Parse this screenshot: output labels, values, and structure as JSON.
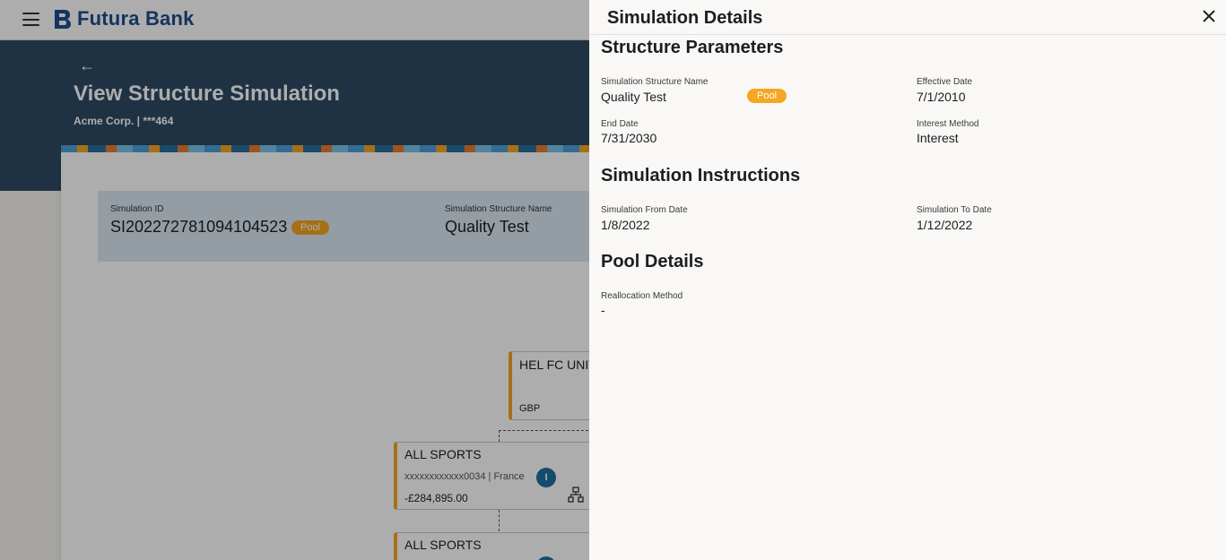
{
  "brand": {
    "name": "Futura Bank"
  },
  "page": {
    "title": "View Structure Simulation",
    "subtitle": "Acme Corp. | ***464",
    "back_icon": "arrow-left-icon"
  },
  "summary": {
    "simulation_id_label": "Simulation ID",
    "simulation_id": "SI202272781094104523",
    "type_badge": "Pool",
    "structure_name_label": "Simulation Structure Name",
    "structure_name": "Quality Test"
  },
  "tree": {
    "root": {
      "title": "HEL FC UNIV",
      "currency": "GBP"
    },
    "children": [
      {
        "title": "ALL SPORTS",
        "account": "xxxxxxxxxxxx0034 | France",
        "badge": "I",
        "amount": "-£284,895.00"
      },
      {
        "title": "ALL SPORTS"
      }
    ]
  },
  "panel": {
    "title": "Simulation Details",
    "close_icon": "close-icon",
    "structure_parameters": {
      "heading": "Structure Parameters",
      "name_label": "Simulation Structure Name",
      "name_value": "Quality Test",
      "badge": "Pool",
      "effective_date_label": "Effective Date",
      "effective_date_value": "7/1/2010",
      "end_date_label": "End Date",
      "end_date_value": "7/31/2030",
      "interest_method_label": "Interest Method",
      "interest_method_value": "Interest"
    },
    "simulation_instructions": {
      "heading": "Simulation Instructions",
      "from_label": "Simulation From Date",
      "from_value": "1/8/2022",
      "to_label": "Simulation To Date",
      "to_value": "1/12/2022"
    },
    "pool_details": {
      "heading": "Pool Details",
      "reallocation_label": "Reallocation Method",
      "reallocation_value": "-"
    }
  },
  "colors": {
    "brand_blue": "#1e4d8c",
    "hero_bg": "#2d4b63",
    "pool_badge": "#f5a623",
    "info_badge": "#1e6fa3"
  }
}
